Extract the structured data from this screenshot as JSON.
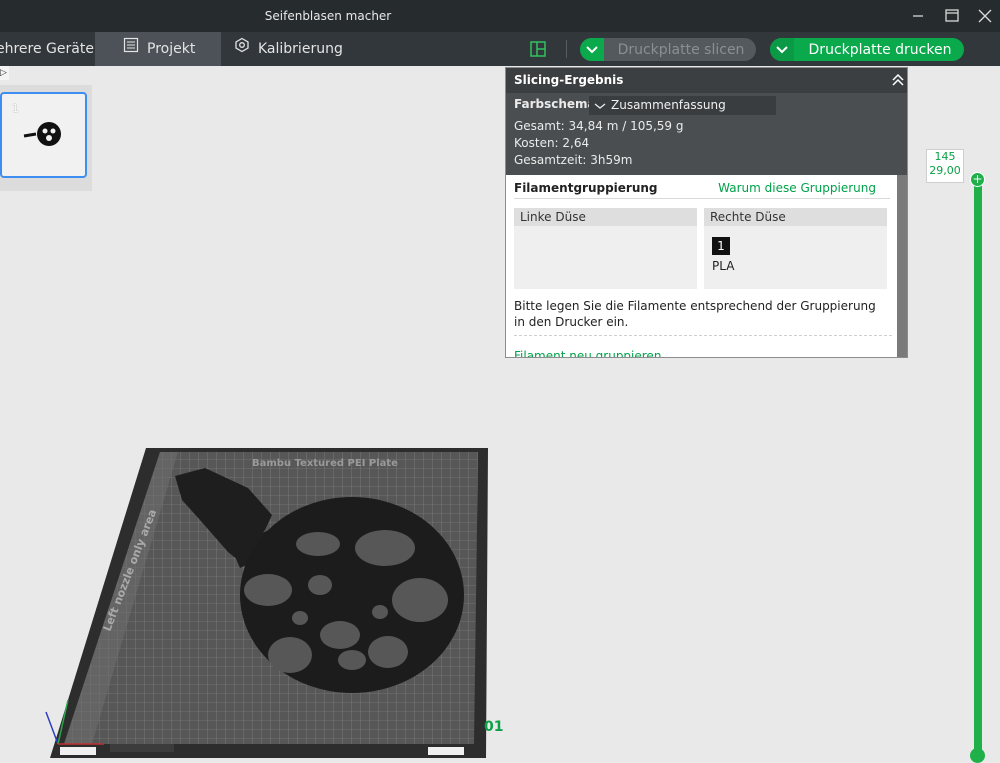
{
  "window": {
    "title": "Seifenblasen macher"
  },
  "toolbar": {
    "tabs": [
      {
        "label": "ehrere Geräte"
      },
      {
        "label": "Projekt"
      },
      {
        "label": "Kalibrierung"
      }
    ],
    "slice_button": "Druckplatte slicen",
    "print_button": "Druckplatte drucken"
  },
  "thumbnail": {
    "index": "1"
  },
  "slicing": {
    "header": "Slicing-Ergebnis",
    "color_scheme_label": "Farbschema",
    "color_scheme_value": "Zusammenfassung",
    "total": "Gesamt:  34,84 m / 105,59 g",
    "cost": "Kosten:  2,64",
    "time": "Gesamtzeit:  3h59m",
    "group_title": "Filamentgruppierung",
    "group_link": "Warum diese Gruppierung",
    "left_nozzle": "Linke Düse",
    "right_nozzle": "Rechte Düse",
    "filament_index": "1",
    "filament_type": "PLA",
    "instruction": "Bitte legen Sie die Filamente entsprechend der Gruppierung in den Drucker ein.",
    "regroup_link": "Filament neu gruppieren"
  },
  "layer_slider": {
    "layer": "145",
    "height": "29,00"
  },
  "plate": {
    "name": "Bambu Textured PEI Plate",
    "side_text": "Left nozzle only area",
    "number": "01"
  },
  "colors": {
    "accent": "#00ae42",
    "toolbar": "#32373b",
    "panel_header": "#3b3f42"
  }
}
